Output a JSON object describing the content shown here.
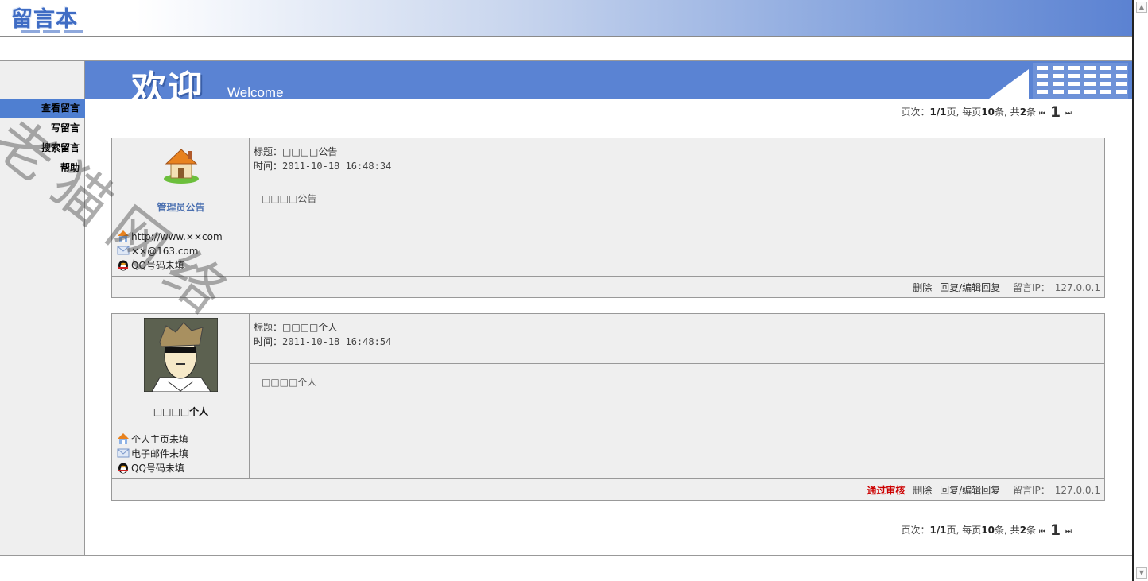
{
  "header": {
    "logo_text": "留言本"
  },
  "banner": {
    "title_cn": "欢迎",
    "title_en": "Welcome"
  },
  "nav": {
    "items": [
      {
        "label": "查看留言",
        "active": true
      },
      {
        "label": "写留言",
        "active": false
      },
      {
        "label": "搜索留言",
        "active": false
      },
      {
        "label": "帮助",
        "active": false
      }
    ]
  },
  "pager": {
    "label": "页次：",
    "current_total": "1/1",
    "page_word": "页,",
    "per_page_prefix": "每页",
    "per_page": "10",
    "per_page_suffix": "条,",
    "total_prefix": "共",
    "total": "2",
    "total_suffix": "条",
    "first_icon": "⏮",
    "page_number": "1",
    "last_icon": "⏭"
  },
  "messages": [
    {
      "avatar": "house-icon",
      "name": "管理员公告",
      "homepage": "http://www.××com",
      "email": "××@163.com",
      "qq": "QQ号码未填",
      "title_label": "标题：",
      "title": "□□□□公告",
      "time_label": "时间：",
      "time": "2011-10-18 16:48:34",
      "content": "□□□□公告",
      "actions": {
        "approve": "",
        "delete": "删除",
        "reply": "回复/编辑回复",
        "ip_label": "留言IP：",
        "ip": "127.0.0.1"
      }
    },
    {
      "avatar": "cartoon-man-avatar",
      "name": "□□□□个人",
      "homepage": "个人主页未填",
      "email": "电子邮件未填",
      "qq": "QQ号码未填",
      "title_label": "标题：",
      "title": "□□□□个人",
      "time_label": "时间：",
      "time": "2011-10-18 16:48:54",
      "content": "□□□□个人",
      "actions": {
        "approve": "通过审核",
        "delete": "删除",
        "reply": "回复/编辑回复",
        "ip_label": "留言IP：",
        "ip": "127.0.0.1"
      }
    }
  ],
  "watermark": "老猫网络",
  "colors": {
    "accent": "#5a83d3",
    "nav_active": "#4f7fd1",
    "approve": "#cc0000",
    "panel": "#efefef"
  }
}
